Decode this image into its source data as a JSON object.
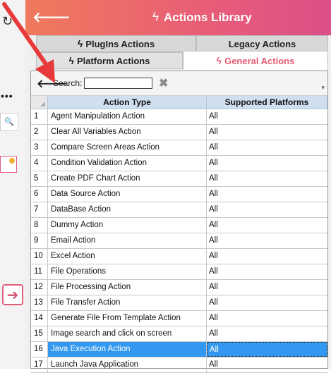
{
  "window": {
    "title": "Actions Library"
  },
  "tabs": {
    "plugins": "PlugIns Actions",
    "legacy": "Legacy Actions",
    "platform": "Platform Actions",
    "general": "General Actions"
  },
  "search": {
    "label": "Search:",
    "value": ""
  },
  "grid": {
    "headers": {
      "type": "Action Type",
      "platforms": "Supported Platforms"
    },
    "rows": [
      {
        "num": "1",
        "name": "Agent Manipulation Action",
        "platform": "All"
      },
      {
        "num": "2",
        "name": "Clear All Variables Action",
        "platform": "All"
      },
      {
        "num": "3",
        "name": "Compare Screen Areas Action",
        "platform": "All"
      },
      {
        "num": "4",
        "name": "Condition Validation Action",
        "platform": "All"
      },
      {
        "num": "5",
        "name": "Create PDF Chart Action",
        "platform": "All"
      },
      {
        "num": "6",
        "name": "Data Source Action",
        "platform": "All"
      },
      {
        "num": "7",
        "name": "DataBase Action",
        "platform": "All"
      },
      {
        "num": "8",
        "name": "Dummy Action",
        "platform": "All"
      },
      {
        "num": "9",
        "name": "Email Action",
        "platform": "All"
      },
      {
        "num": "10",
        "name": "Excel Action",
        "platform": "All"
      },
      {
        "num": "11",
        "name": "File Operations",
        "platform": "All"
      },
      {
        "num": "12",
        "name": "File Processing Action",
        "platform": "All"
      },
      {
        "num": "13",
        "name": "File Transfer Action",
        "platform": "All"
      },
      {
        "num": "14",
        "name": "Generate File From Template Action",
        "platform": "All"
      },
      {
        "num": "15",
        "name": "Image search and click on screen",
        "platform": "All"
      },
      {
        "num": "16",
        "name": "Java Execution Action",
        "platform": "All"
      },
      {
        "num": "17",
        "name": "Launch Java Application",
        "platform": "All"
      }
    ],
    "selected_row": "16"
  },
  "colors": {
    "title_gradient_start": "#ef7a5c",
    "title_gradient_end": "#db4f88",
    "accent": "#e45a72",
    "selection": "#3399f0",
    "header_bg": "#cfdff0",
    "annotation_arrow": "#e83a3a"
  },
  "icons": {
    "back": "arrow-left-icon",
    "bolt": "lightning-bolt-icon",
    "clear": "clear-x-icon",
    "search": "magnifier-icon"
  }
}
